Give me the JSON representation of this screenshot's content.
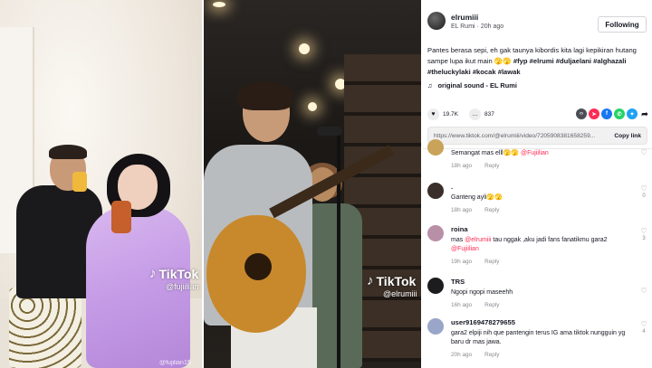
{
  "video_left": {
    "watermark_brand": "TikTok",
    "watermark_user": "@fujiilian",
    "bottom_text": "@fujilian15"
  },
  "video_middle": {
    "watermark_brand": "TikTok",
    "watermark_user": "@elrumiii"
  },
  "post": {
    "username": "elrumiii",
    "display_name": "EL Rumi",
    "time_ago": "20h ago",
    "follow_label": "Following",
    "caption_text": "Pantes berasa sepi, eh gak taunya kibordis kita lagi kepikiran hutang sampe lupa ikut main 🫣🫣",
    "hashtags": [
      "#fyp",
      "#elrumi",
      "#duljaelani",
      "#alghazali",
      "#theluckylaki",
      "#kocak",
      "#lawak"
    ],
    "sound_icon": "music-note-icon",
    "sound": "original sound - EL Rumi",
    "likes": "19.7K",
    "comments": "837",
    "link_url": "https://www.tiktok.com/@elrumiii/video/7205908381658259...",
    "copy_label": "Copy link",
    "share_icons": [
      {
        "name": "embed-icon",
        "color": "#4c4d55",
        "glyph": "</>"
      },
      {
        "name": "send-icon",
        "color": "#fe2c55",
        "glyph": "➤"
      },
      {
        "name": "facebook-icon",
        "color": "#1877f2",
        "glyph": "f"
      },
      {
        "name": "whatsapp-icon",
        "color": "#25d366",
        "glyph": "✆"
      },
      {
        "name": "twitter-icon",
        "color": "#1da1f2",
        "glyph": "✦"
      },
      {
        "name": "share-arrow-icon",
        "color": "#161823",
        "glyph": "➦"
      }
    ]
  },
  "comments": [
    {
      "user": "",
      "text": "Semangat mas elll🫣🫣",
      "mention": "@Fujiilian",
      "time": "18h ago",
      "reply": "Reply",
      "likes": "",
      "avatar_color": "#c9a35a"
    },
    {
      "user": ".",
      "text": "Ganteng ayli🫣🫣",
      "mention": "",
      "time": "18h ago",
      "reply": "Reply",
      "likes": "0",
      "avatar_color": "#3a2f2a"
    },
    {
      "user": "roina",
      "text": "mas",
      "mention": "@elrumiii",
      "text2": "tau nggak ,aku jadi fans fanatikmu gara2",
      "mention2": "@Fujiilian",
      "time": "19h ago",
      "reply": "Reply",
      "likes": "3",
      "avatar_color": "#b98fa8"
    },
    {
      "user": "TRS",
      "text": "Ngopi ngopi maseehh",
      "mention": "",
      "time": "16h ago",
      "reply": "Reply",
      "likes": "",
      "avatar_color": "#1c1c1e"
    },
    {
      "user": "user9169478279655",
      "text": "gara2 elpiji nih que pantengin terus IG ama tiktok nungguin yg baru dr mas jawa.",
      "mention": "",
      "time": "20h ago",
      "reply": "Reply",
      "likes": "4",
      "avatar_color": "#9aa6c9"
    }
  ]
}
